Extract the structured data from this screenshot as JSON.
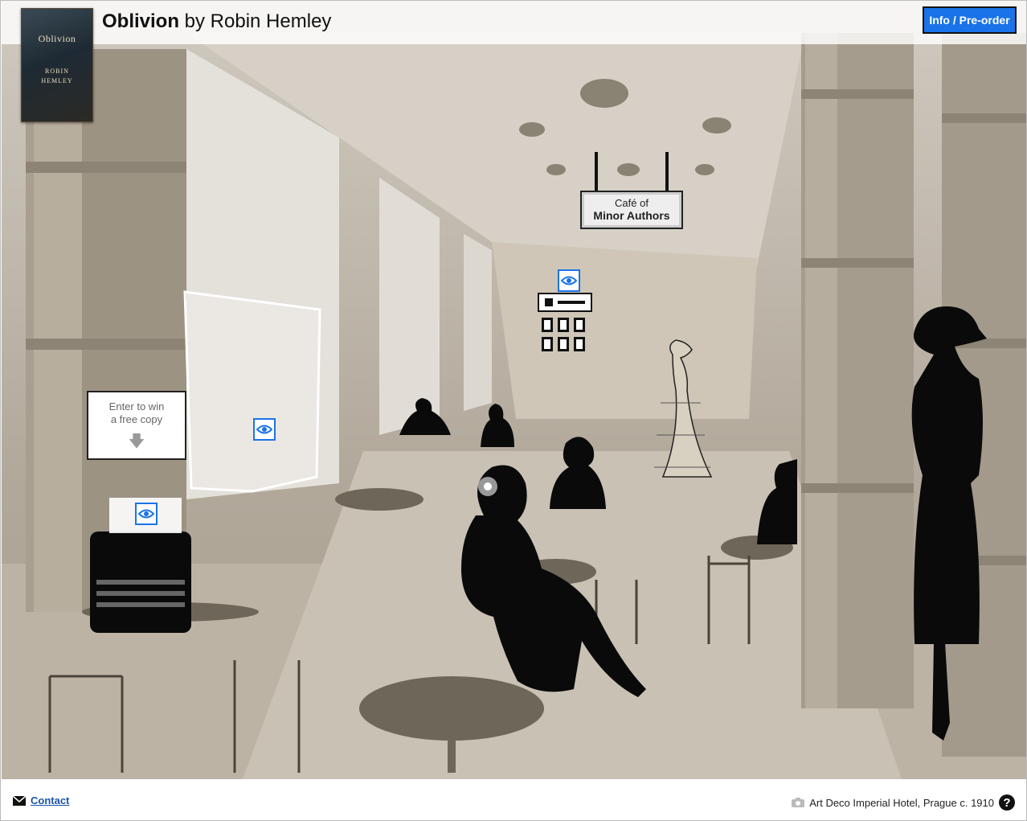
{
  "header": {
    "book_title": "Oblivion",
    "book_author_text": " by Robin Hemley",
    "cover": {
      "title": "Oblivion",
      "author_line1": "ROBIN",
      "author_line2": "HEMLEY"
    },
    "cta_label": "Info / Pre-order"
  },
  "scene": {
    "sign": {
      "line1": "Café of",
      "line2": "Minor Authors"
    },
    "contest": {
      "line1": "Enter to win",
      "line2": "a free copy",
      "arrow": "🡇"
    },
    "hotspots": [
      "eye-icon",
      "eye-icon",
      "eye-icon"
    ]
  },
  "footer": {
    "contact_label": "Contact",
    "photo_credit": "Art Deco Imperial Hotel, Prague c. 1910",
    "help_glyph": "?"
  },
  "colors": {
    "accent": "#1a73e8",
    "scene_sepia": "#b8af9f"
  }
}
